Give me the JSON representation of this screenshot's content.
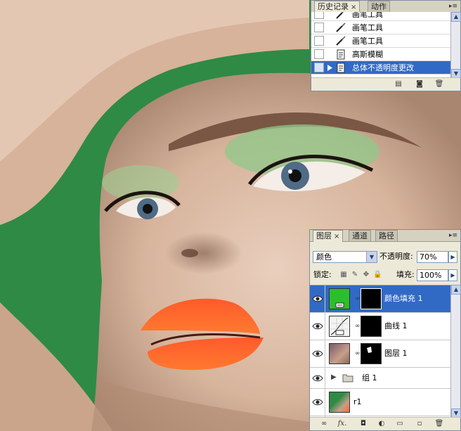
{
  "history_panel": {
    "tabs": [
      {
        "label": "历史记录",
        "active": true,
        "close": "×"
      },
      {
        "label": "动作",
        "active": false
      }
    ],
    "menu_icon": "panel-menu-icon",
    "items": [
      {
        "label": "画笔工具",
        "icon": "brush-icon",
        "selected": false
      },
      {
        "label": "画笔工具",
        "icon": "brush-icon",
        "selected": false
      },
      {
        "label": "画笔工具",
        "icon": "brush-icon",
        "selected": false
      },
      {
        "label": "高斯模糊",
        "icon": "filter-step-icon",
        "selected": false
      },
      {
        "label": "总体不透明度更改",
        "icon": "filter-step-icon",
        "selected": true
      }
    ],
    "footer_buttons": [
      "new-document-from-state-icon",
      "snapshot-camera-icon",
      "trash-icon"
    ]
  },
  "layers_panel": {
    "tabs": [
      {
        "label": "图层",
        "active": true,
        "close": "×"
      },
      {
        "label": "通道",
        "active": false
      },
      {
        "label": "路径",
        "active": false
      }
    ],
    "blend_mode": "颜色",
    "opacity_label": "不透明度:",
    "opacity_value": "70%",
    "lock_label": "锁定:",
    "fill_label": "填充:",
    "fill_value": "100%",
    "layers": [
      {
        "name": "颜色填充 1",
        "type": "fill",
        "selected": true,
        "visible": true,
        "has_mask": true,
        "fill_color": "#2bbf2b"
      },
      {
        "name": "曲线 1",
        "type": "curves",
        "selected": false,
        "visible": true,
        "has_mask": true
      },
      {
        "name": "图层 1",
        "type": "image",
        "selected": false,
        "visible": true,
        "has_mask": true
      },
      {
        "name": "组 1",
        "type": "group",
        "selected": false,
        "visible": true,
        "has_mask": false
      },
      {
        "name": "r1",
        "type": "image",
        "selected": false,
        "visible": true,
        "has_mask": false
      }
    ],
    "footer_buttons": [
      "link-layers-icon",
      "fx-icon",
      "add-mask-icon",
      "adjustment-layer-icon",
      "new-group-icon",
      "new-layer-icon",
      "trash-icon"
    ]
  },
  "colors": {
    "selection": "#316ac5",
    "panel_bg": "#ece9d8",
    "backdrop_green": "#2f8a45",
    "fill_green": "#2bbf2b"
  }
}
